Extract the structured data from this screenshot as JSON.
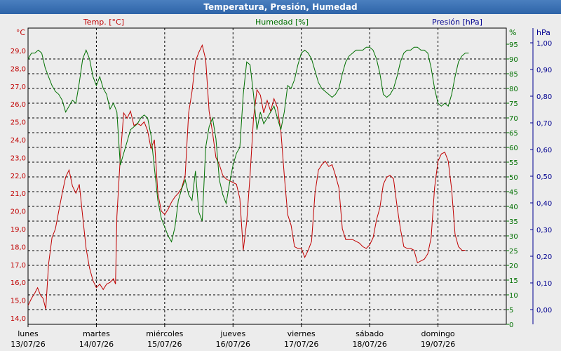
{
  "window": {
    "title": "Temperatura, Presión, Humedad"
  },
  "colors": {
    "temp": "#c00000",
    "hum": "#007000",
    "pres": "#000090",
    "bg": "#ececec"
  },
  "chart_data": {
    "type": "line",
    "legend": {
      "temp": "Temp. [°C]",
      "hum": "Humedad [%]",
      "pres": "Presión [hPa]"
    },
    "axes": {
      "temp": {
        "unit": "°C",
        "min": 14,
        "max": 29,
        "ticks": [
          "14,0",
          "15,0",
          "16,0",
          "17,0",
          "18,0",
          "19,0",
          "20,0",
          "21,0",
          "22,0",
          "23,0",
          "24,0",
          "25,0",
          "26,0",
          "27,0",
          "28,0",
          "29,0"
        ]
      },
      "hum": {
        "unit": "%",
        "min": 0,
        "max": 95,
        "ticks": [
          "0",
          "5",
          "10",
          "15",
          "20",
          "25",
          "30",
          "35",
          "40",
          "45",
          "50",
          "55",
          "60",
          "65",
          "70",
          "75",
          "80",
          "85",
          "90",
          "95"
        ]
      },
      "pres": {
        "unit": "hPa",
        "min": 0,
        "max": 1,
        "ticks": [
          "0,00",
          "0,10",
          "0,20",
          "0,30",
          "0,40",
          "0,50",
          "0,60",
          "0,70",
          "0,80",
          "0,90",
          "1,00"
        ]
      }
    },
    "grid": true,
    "days": [
      {
        "day": "lunes",
        "date": "13/07/26"
      },
      {
        "day": "martes",
        "date": "14/07/26"
      },
      {
        "day": "miércoles",
        "date": "15/07/26"
      },
      {
        "day": "jueves",
        "date": "16/07/26"
      },
      {
        "day": "viernes",
        "date": "17/07/26"
      },
      {
        "day": "sábado",
        "date": "18/07/26"
      },
      {
        "day": "domingo",
        "date": "19/07/26"
      }
    ],
    "series": [
      {
        "name": "Temp. [°C]",
        "axis": "temp",
        "points": [
          [
            0,
            14.7
          ],
          [
            0.05,
            15.1
          ],
          [
            0.1,
            15.4
          ],
          [
            0.14,
            15.7
          ],
          [
            0.18,
            15.3
          ],
          [
            0.22,
            15.1
          ],
          [
            0.26,
            14.5
          ],
          [
            0.3,
            17.0
          ],
          [
            0.35,
            18.5
          ],
          [
            0.4,
            19.0
          ],
          [
            0.45,
            20.0
          ],
          [
            0.5,
            21.0
          ],
          [
            0.55,
            21.9
          ],
          [
            0.6,
            22.3
          ],
          [
            0.65,
            21.4
          ],
          [
            0.7,
            21.0
          ],
          [
            0.75,
            21.5
          ],
          [
            0.8,
            19.7
          ],
          [
            0.85,
            17.9
          ],
          [
            0.9,
            16.8
          ],
          [
            0.95,
            16.1
          ],
          [
            1.0,
            15.7
          ],
          [
            1.05,
            15.9
          ],
          [
            1.1,
            15.6
          ],
          [
            1.15,
            15.9
          ],
          [
            1.2,
            16.0
          ],
          [
            1.25,
            16.2
          ],
          [
            1.28,
            15.9
          ],
          [
            1.3,
            19.7
          ],
          [
            1.35,
            23.0
          ],
          [
            1.4,
            25.5
          ],
          [
            1.45,
            25.2
          ],
          [
            1.5,
            25.6
          ],
          [
            1.55,
            24.8
          ],
          [
            1.6,
            24.9
          ],
          [
            1.65,
            24.8
          ],
          [
            1.7,
            25.0
          ],
          [
            1.75,
            24.5
          ],
          [
            1.8,
            23.5
          ],
          [
            1.85,
            24.0
          ],
          [
            1.9,
            21.0
          ],
          [
            1.95,
            20.0
          ],
          [
            2.0,
            19.8
          ],
          [
            2.05,
            20.1
          ],
          [
            2.1,
            20.5
          ],
          [
            2.15,
            20.8
          ],
          [
            2.2,
            21.0
          ],
          [
            2.25,
            21.3
          ],
          [
            2.3,
            22.0
          ],
          [
            2.35,
            25.5
          ],
          [
            2.4,
            26.7
          ],
          [
            2.45,
            28.4
          ],
          [
            2.5,
            28.9
          ],
          [
            2.55,
            29.3
          ],
          [
            2.6,
            28.5
          ],
          [
            2.65,
            25.6
          ],
          [
            2.7,
            24.4
          ],
          [
            2.75,
            23.0
          ],
          [
            2.8,
            22.6
          ],
          [
            2.85,
            22.0
          ],
          [
            2.9,
            21.8
          ],
          [
            2.95,
            21.7
          ],
          [
            3.0,
            21.6
          ],
          [
            3.05,
            21.5
          ],
          [
            3.1,
            20.7
          ],
          [
            3.15,
            17.8
          ],
          [
            3.2,
            19.4
          ],
          [
            3.25,
            22.0
          ],
          [
            3.3,
            25.2
          ],
          [
            3.35,
            26.8
          ],
          [
            3.4,
            26.5
          ],
          [
            3.45,
            25.5
          ],
          [
            3.5,
            26.2
          ],
          [
            3.55,
            25.6
          ],
          [
            3.6,
            26.3
          ],
          [
            3.65,
            25.8
          ],
          [
            3.7,
            24.5
          ],
          [
            3.75,
            22.0
          ],
          [
            3.8,
            19.8
          ],
          [
            3.85,
            19.2
          ],
          [
            3.9,
            18.0
          ],
          [
            3.95,
            17.9
          ],
          [
            4.0,
            17.9
          ],
          [
            4.05,
            17.4
          ],
          [
            4.1,
            17.8
          ],
          [
            4.15,
            18.3
          ],
          [
            4.2,
            21.0
          ],
          [
            4.25,
            22.3
          ],
          [
            4.3,
            22.6
          ],
          [
            4.35,
            22.8
          ],
          [
            4.4,
            22.5
          ],
          [
            4.45,
            22.6
          ],
          [
            4.5,
            22.0
          ],
          [
            4.55,
            21.3
          ],
          [
            4.6,
            19.0
          ],
          [
            4.65,
            18.4
          ],
          [
            4.7,
            18.4
          ],
          [
            4.75,
            18.4
          ],
          [
            4.8,
            18.3
          ],
          [
            4.85,
            18.2
          ],
          [
            4.9,
            18.0
          ],
          [
            4.95,
            17.9
          ],
          [
            5.0,
            18.1
          ],
          [
            5.05,
            18.5
          ],
          [
            5.1,
            19.5
          ],
          [
            5.15,
            20.2
          ],
          [
            5.2,
            21.5
          ],
          [
            5.25,
            21.9
          ],
          [
            5.3,
            22.0
          ],
          [
            5.35,
            21.8
          ],
          [
            5.4,
            20.3
          ],
          [
            5.45,
            19.0
          ],
          [
            5.5,
            18.0
          ],
          [
            5.55,
            17.9
          ],
          [
            5.6,
            17.9
          ],
          [
            5.65,
            17.8
          ],
          [
            5.7,
            17.1
          ],
          [
            5.75,
            17.2
          ],
          [
            5.8,
            17.3
          ],
          [
            5.85,
            17.6
          ],
          [
            5.9,
            18.5
          ],
          [
            5.95,
            21.3
          ],
          [
            6.0,
            22.8
          ],
          [
            6.05,
            23.2
          ],
          [
            6.1,
            23.3
          ],
          [
            6.15,
            22.8
          ],
          [
            6.2,
            21.2
          ],
          [
            6.25,
            18.7
          ],
          [
            6.3,
            18.0
          ],
          [
            6.35,
            17.8
          ],
          [
            6.4,
            17.8
          ]
        ]
      },
      {
        "name": "Humedad [%]",
        "axis": "hum",
        "points": [
          [
            0,
            90
          ],
          [
            0.05,
            92
          ],
          [
            0.1,
            92
          ],
          [
            0.15,
            93
          ],
          [
            0.2,
            92
          ],
          [
            0.25,
            87
          ],
          [
            0.3,
            84
          ],
          [
            0.35,
            81
          ],
          [
            0.4,
            79
          ],
          [
            0.45,
            78
          ],
          [
            0.5,
            76
          ],
          [
            0.55,
            72
          ],
          [
            0.6,
            74
          ],
          [
            0.65,
            76
          ],
          [
            0.7,
            75
          ],
          [
            0.75,
            82
          ],
          [
            0.8,
            90
          ],
          [
            0.85,
            93
          ],
          [
            0.9,
            90
          ],
          [
            0.95,
            84
          ],
          [
            1.0,
            81
          ],
          [
            1.05,
            84
          ],
          [
            1.1,
            80
          ],
          [
            1.15,
            78
          ],
          [
            1.2,
            73
          ],
          [
            1.25,
            75
          ],
          [
            1.3,
            72
          ],
          [
            1.35,
            54
          ],
          [
            1.4,
            58
          ],
          [
            1.45,
            62
          ],
          [
            1.5,
            66
          ],
          [
            1.55,
            67
          ],
          [
            1.6,
            68
          ],
          [
            1.65,
            70
          ],
          [
            1.7,
            71
          ],
          [
            1.75,
            70
          ],
          [
            1.8,
            64
          ],
          [
            1.85,
            53
          ],
          [
            1.9,
            42
          ],
          [
            1.95,
            36
          ],
          [
            2.0,
            33
          ],
          [
            2.05,
            30
          ],
          [
            2.1,
            28
          ],
          [
            2.15,
            33
          ],
          [
            2.2,
            42
          ],
          [
            2.25,
            46
          ],
          [
            2.3,
            49
          ],
          [
            2.35,
            44
          ],
          [
            2.4,
            42
          ],
          [
            2.45,
            52
          ],
          [
            2.5,
            38
          ],
          [
            2.55,
            35
          ],
          [
            2.6,
            60
          ],
          [
            2.65,
            67
          ],
          [
            2.7,
            70
          ],
          [
            2.75,
            63
          ],
          [
            2.8,
            49
          ],
          [
            2.85,
            44
          ],
          [
            2.9,
            41
          ],
          [
            2.95,
            48
          ],
          [
            3.0,
            54
          ],
          [
            3.05,
            58
          ],
          [
            3.1,
            60
          ],
          [
            3.15,
            78
          ],
          [
            3.2,
            89
          ],
          [
            3.25,
            88
          ],
          [
            3.3,
            78
          ],
          [
            3.35,
            66
          ],
          [
            3.4,
            72
          ],
          [
            3.45,
            68
          ],
          [
            3.5,
            70
          ],
          [
            3.55,
            72
          ],
          [
            3.6,
            74
          ],
          [
            3.65,
            70
          ],
          [
            3.7,
            66
          ],
          [
            3.75,
            72
          ],
          [
            3.8,
            81
          ],
          [
            3.85,
            80
          ],
          [
            3.9,
            83
          ],
          [
            3.95,
            88
          ],
          [
            4.0,
            92
          ],
          [
            4.05,
            93
          ],
          [
            4.1,
            92
          ],
          [
            4.15,
            90
          ],
          [
            4.2,
            86
          ],
          [
            4.25,
            82
          ],
          [
            4.3,
            80
          ],
          [
            4.35,
            79
          ],
          [
            4.4,
            78
          ],
          [
            4.45,
            77
          ],
          [
            4.5,
            78
          ],
          [
            4.55,
            80
          ],
          [
            4.6,
            85
          ],
          [
            4.65,
            89
          ],
          [
            4.7,
            91
          ],
          [
            4.75,
            92
          ],
          [
            4.8,
            93
          ],
          [
            4.85,
            93
          ],
          [
            4.9,
            93
          ],
          [
            4.95,
            94
          ],
          [
            5.0,
            94
          ],
          [
            5.05,
            93
          ],
          [
            5.1,
            90
          ],
          [
            5.15,
            85
          ],
          [
            5.2,
            78
          ],
          [
            5.25,
            77
          ],
          [
            5.3,
            78
          ],
          [
            5.35,
            80
          ],
          [
            5.4,
            84
          ],
          [
            5.45,
            89
          ],
          [
            5.5,
            92
          ],
          [
            5.55,
            93
          ],
          [
            5.6,
            93
          ],
          [
            5.65,
            94
          ],
          [
            5.7,
            94
          ],
          [
            5.75,
            93
          ],
          [
            5.8,
            93
          ],
          [
            5.85,
            92
          ],
          [
            5.9,
            87
          ],
          [
            5.95,
            80
          ],
          [
            6.0,
            75
          ],
          [
            6.05,
            74
          ],
          [
            6.1,
            75
          ],
          [
            6.15,
            74
          ],
          [
            6.2,
            78
          ],
          [
            6.25,
            84
          ],
          [
            6.3,
            89
          ],
          [
            6.35,
            91
          ],
          [
            6.4,
            92
          ],
          [
            6.45,
            92
          ]
        ]
      }
    ]
  }
}
